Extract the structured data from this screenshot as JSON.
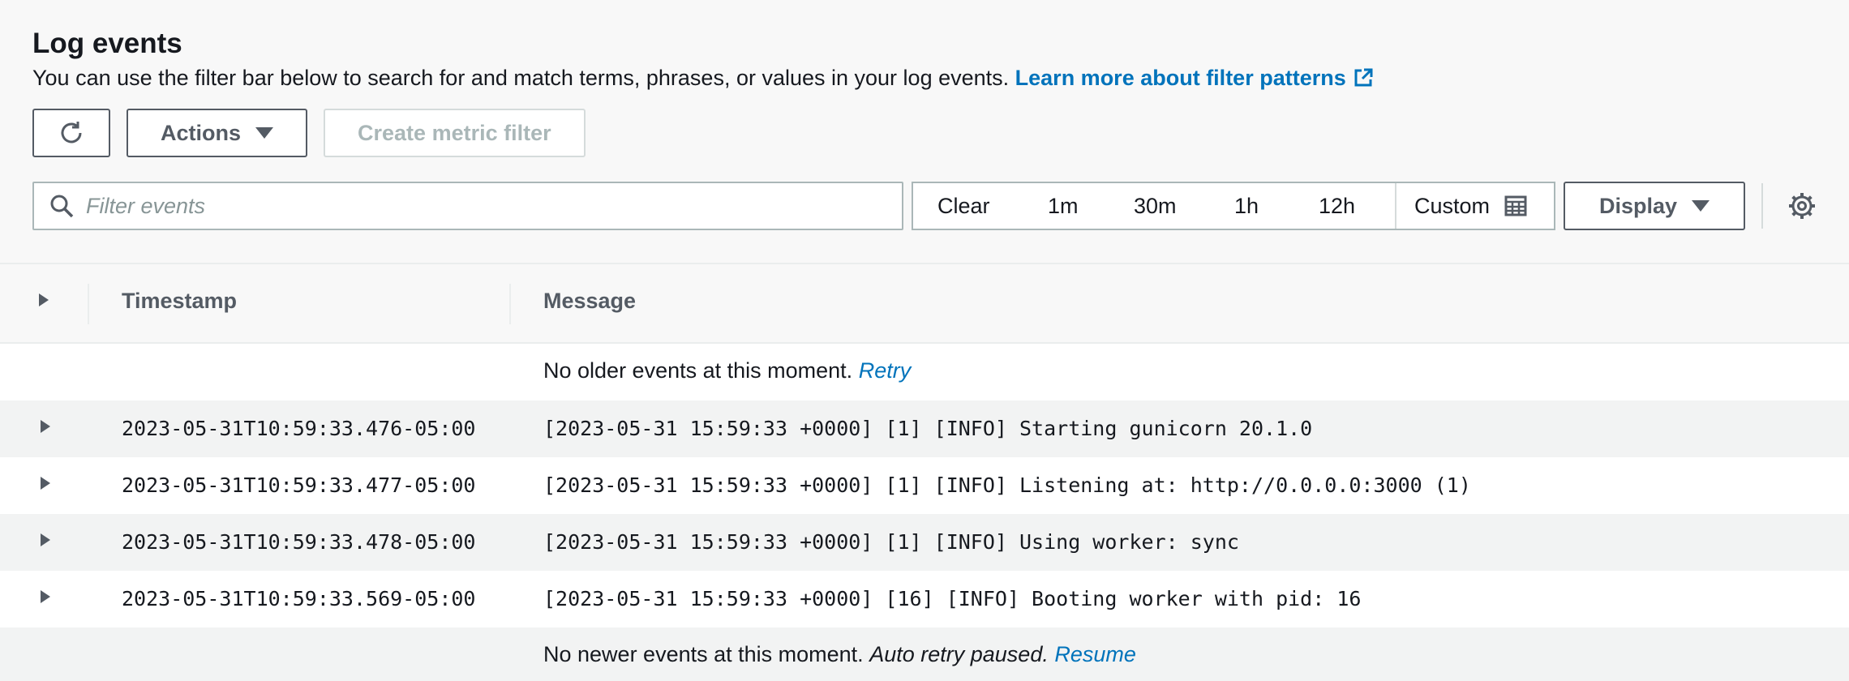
{
  "header": {
    "title": "Log events",
    "description": "You can use the filter bar below to search for and match terms, phrases, or values in your log events.",
    "learn_more_link": "Learn more about filter patterns"
  },
  "toolbar": {
    "refresh_icon": "refresh-icon",
    "actions_label": "Actions",
    "create_metric_filter_label": "Create metric filter"
  },
  "filter": {
    "placeholder": "Filter events",
    "value": ""
  },
  "time_range": {
    "options": [
      "Clear",
      "1m",
      "30m",
      "1h",
      "12h"
    ],
    "custom_label": "Custom"
  },
  "display_label": "Display",
  "table": {
    "columns": {
      "timestamp": "Timestamp",
      "message": "Message"
    },
    "older_notice": {
      "text": "No older events at this moment.",
      "link": "Retry"
    },
    "rows": [
      {
        "timestamp": "2023-05-31T10:59:33.476-05:00",
        "message": "[2023-05-31 15:59:33 +0000] [1] [INFO] Starting gunicorn 20.1.0"
      },
      {
        "timestamp": "2023-05-31T10:59:33.477-05:00",
        "message": "[2023-05-31 15:59:33 +0000] [1] [INFO] Listening at: http://0.0.0.0:3000 (1)"
      },
      {
        "timestamp": "2023-05-31T10:59:33.478-05:00",
        "message": "[2023-05-31 15:59:33 +0000] [1] [INFO] Using worker: sync"
      },
      {
        "timestamp": "2023-05-31T10:59:33.569-05:00",
        "message": "[2023-05-31 15:59:33 +0000] [16] [INFO] Booting worker with pid: 16"
      }
    ],
    "newer_notice": {
      "text": "No newer events at this moment.",
      "paused": "Auto retry paused.",
      "link": "Resume"
    }
  },
  "colors": {
    "link": "#0073bb",
    "text": "#16191f",
    "muted": "#545b64",
    "disabled": "#aab7b8"
  }
}
